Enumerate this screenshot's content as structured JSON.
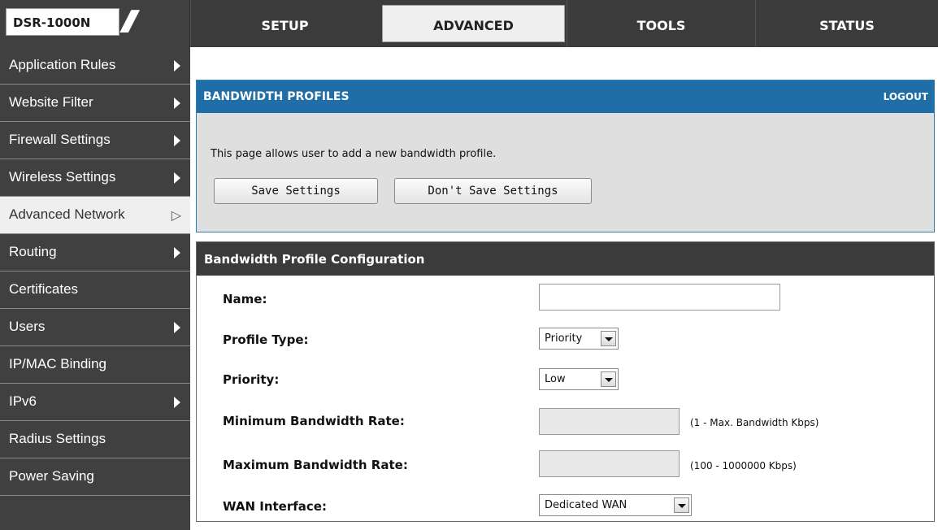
{
  "brand": {
    "model": "DSR-1000N"
  },
  "top_tabs": [
    {
      "label": "SETUP",
      "active": false
    },
    {
      "label": "ADVANCED",
      "active": true
    },
    {
      "label": "TOOLS",
      "active": false
    },
    {
      "label": "STATUS",
      "active": false
    }
  ],
  "sidebar": {
    "items": [
      {
        "label": "Application Rules",
        "arrow": true
      },
      {
        "label": "Website Filter",
        "arrow": true
      },
      {
        "label": "Firewall Settings",
        "arrow": true
      },
      {
        "label": "Wireless Settings",
        "arrow": true
      },
      {
        "label": "Advanced Network",
        "arrow": true,
        "active": true
      },
      {
        "label": "Routing",
        "arrow": true
      },
      {
        "label": "Certificates",
        "arrow": false
      },
      {
        "label": "Users",
        "arrow": true
      },
      {
        "label": "IP/MAC Binding",
        "arrow": false
      },
      {
        "label": "IPv6",
        "arrow": true
      },
      {
        "label": "Radius Settings",
        "arrow": false
      },
      {
        "label": "Power Saving",
        "arrow": false
      }
    ]
  },
  "header_panel": {
    "title": "BANDWIDTH PROFILES",
    "logout": "LOGOUT",
    "description": "This page allows user to add a new bandwidth profile.",
    "save_label": "Save Settings",
    "dont_save_label": "Don't Save Settings"
  },
  "config": {
    "title": "Bandwidth Profile Configuration",
    "name_label": "Name:",
    "name_value": "",
    "profile_type_label": "Profile Type:",
    "profile_type_value": "Priority",
    "priority_label": "Priority:",
    "priority_value": "Low",
    "min_rate_label": "Minimum Bandwidth Rate:",
    "min_rate_hint": "(1 - Max. Bandwidth Kbps)",
    "max_rate_label": "Maximum Bandwidth Rate:",
    "max_rate_hint": "(100 - 1000000 Kbps)",
    "wan_label": "WAN Interface:",
    "wan_value": "Dedicated WAN"
  }
}
